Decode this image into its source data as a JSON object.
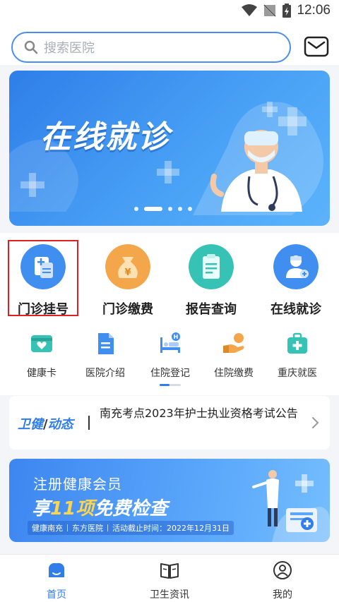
{
  "status_bar": {
    "time": "12:06"
  },
  "search": {
    "placeholder": "搜索医院"
  },
  "banner": {
    "title": "在线就诊",
    "slide_count": 5,
    "active_slide": 2
  },
  "main_services": [
    {
      "label": "门诊挂号"
    },
    {
      "label": "门诊缴费"
    },
    {
      "label": "报告查询"
    },
    {
      "label": "在线就诊"
    }
  ],
  "sub_services": [
    {
      "label": "健康卡"
    },
    {
      "label": "医院介绍"
    },
    {
      "label": "住院登记"
    },
    {
      "label": "住院缴费"
    },
    {
      "label": "重庆就医"
    }
  ],
  "news": {
    "tag_part1": "卫健",
    "tag_slash": "/",
    "tag_part2": "动态",
    "headline": "南充考点2023年护士执业资格考试公告"
  },
  "promo": {
    "line1": "注册健康会员",
    "line2_prefix": "享",
    "line2_highlight": "11项",
    "line2_suffix": "免费检查",
    "footer_left": "健康南充",
    "footer_mid": "东方医院",
    "footer_right": "活动截止时间：2022年12月31日"
  },
  "bottom_nav": [
    {
      "label": "首页",
      "icon": "home-icon",
      "active": true
    },
    {
      "label": "卫生资讯",
      "icon": "book-icon",
      "active": false
    },
    {
      "label": "我的",
      "icon": "user-icon",
      "active": false
    }
  ],
  "colors": {
    "accent": "#2f7ee9",
    "highlight_border": "#e02020"
  }
}
